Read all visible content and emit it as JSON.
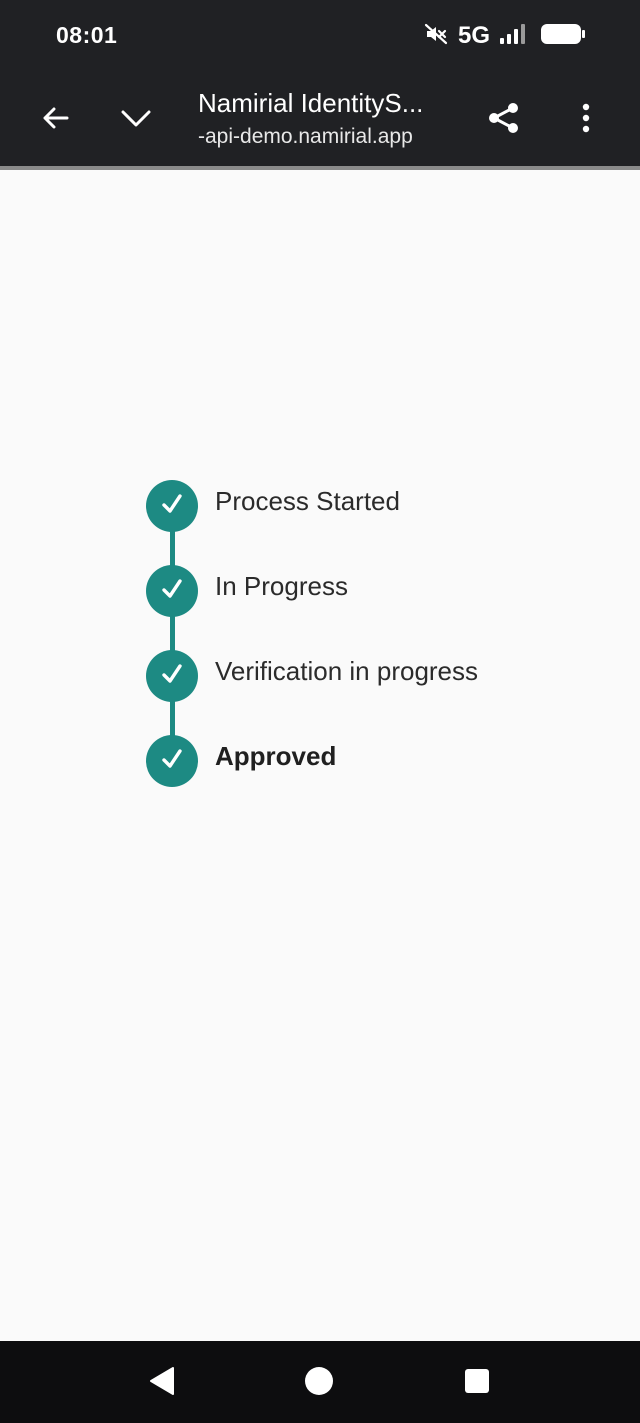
{
  "status_bar": {
    "time": "08:01",
    "network": "5G",
    "icons": [
      "mute-icon",
      "signal-icon",
      "battery-icon"
    ]
  },
  "toolbar": {
    "title": "Namirial IdentityS...",
    "url": "-api-demo.namirial.app",
    "icons": [
      "back-arrow-icon",
      "chevron-down-icon",
      "share-icon",
      "more-vert-icon"
    ]
  },
  "steps": [
    {
      "label": "Process Started",
      "status": "complete"
    },
    {
      "label": "In Progress",
      "status": "complete"
    },
    {
      "label": "Verification in progress",
      "status": "complete"
    },
    {
      "label": "Approved",
      "status": "complete",
      "current": true
    }
  ],
  "nav_bar": {
    "icons": [
      "nav-back-icon",
      "nav-home-icon",
      "nav-recents-icon"
    ]
  },
  "colors": {
    "accent": "#1d8a83",
    "toolbar_bg": "#202124",
    "page_bg": "#fafafa",
    "nav_bg": "#0d0d0f"
  }
}
